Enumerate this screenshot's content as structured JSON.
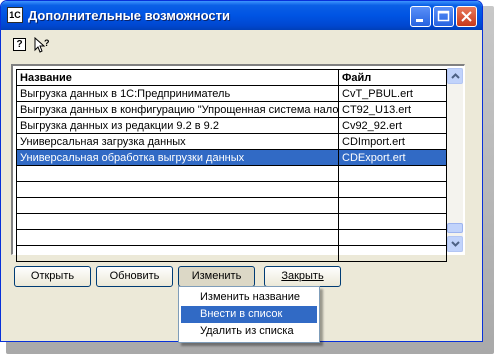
{
  "window": {
    "title": "Дополнительные возможности",
    "icon_text": "1С"
  },
  "titlebar_buttons": [
    "minimize-icon",
    "maximize-icon",
    "close-icon"
  ],
  "toolbar": {
    "help_glyph": "?",
    "whats_this_icon": "whats-this-icon"
  },
  "table": {
    "columns": [
      "Название",
      "Файл"
    ],
    "rows": [
      {
        "name": "Выгрузка данных в 1С:Предприниматель",
        "file": "CvT_PBUL.ert",
        "selected": false
      },
      {
        "name": "Выгрузка данных в конфигурацию \"Упрощенная система налогообложения\"",
        "file": "CT92_U13.ert",
        "selected": false
      },
      {
        "name": "Выгрузка данных из редакции 9.2 в 9.2",
        "file": "Cv92_92.ert",
        "selected": false
      },
      {
        "name": "Универсальная загрузка данных",
        "file": "CDImport.ert",
        "selected": false
      },
      {
        "name": "Универсальная обработка выгрузки данных",
        "file": "CDExport.ert",
        "selected": true
      }
    ],
    "empty_rows": 6
  },
  "buttons": {
    "open": "Открыть",
    "refresh": "Обновить",
    "edit": "Изменить",
    "close": "Закрыть"
  },
  "context_menu": {
    "items": [
      {
        "label": "Изменить название",
        "active": false
      },
      {
        "label": "Внести в список",
        "active": true
      },
      {
        "label": "Удалить из списка",
        "active": false
      }
    ]
  },
  "colors": {
    "titlebar": "#0054e3",
    "selection": "#316ac5",
    "window_bg": "#ece9d8"
  }
}
